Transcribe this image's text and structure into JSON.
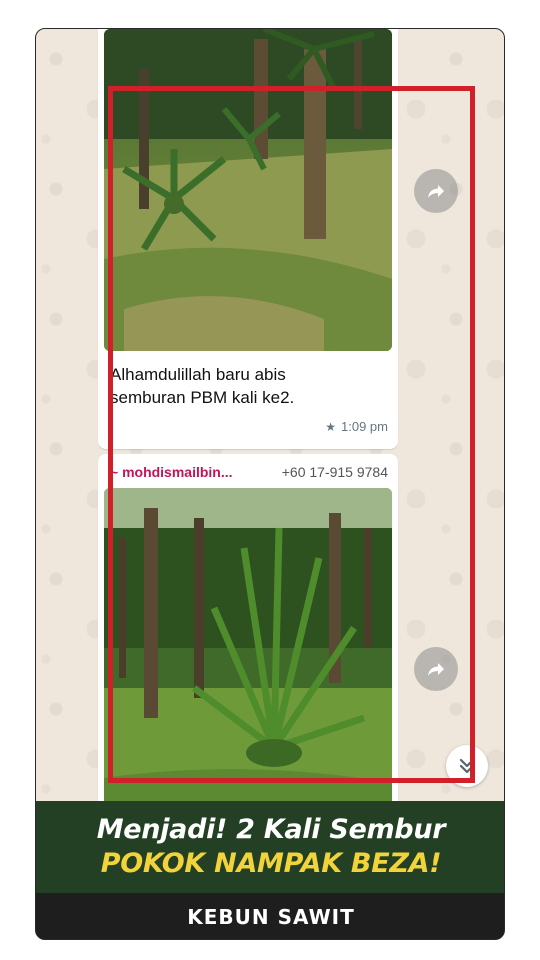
{
  "messages": [
    {
      "caption_line1": "Alhamdulillah baru abis",
      "caption_line2": "semburan PBM kali ke2.",
      "time": "1:09 pm",
      "starred_icon": "star-icon"
    },
    {
      "sender_name": "~ mohdismailbin...",
      "sender_phone": "+60 17-915 9784"
    }
  ],
  "overlay": {
    "headline_line1": "Menjadi! 2 Kali Sembur",
    "headline_line2": "POKOK NAMPAK BEZA!",
    "footer_label": "KEBUN SAWIT"
  },
  "colors": {
    "highlight_frame": "#d0202a",
    "headline_band": "#234024",
    "headline_accent": "#f2d33a",
    "sender_name": "#c4145a"
  },
  "icons": [
    "forward-icon",
    "scroll-down-icon",
    "star-icon"
  ]
}
